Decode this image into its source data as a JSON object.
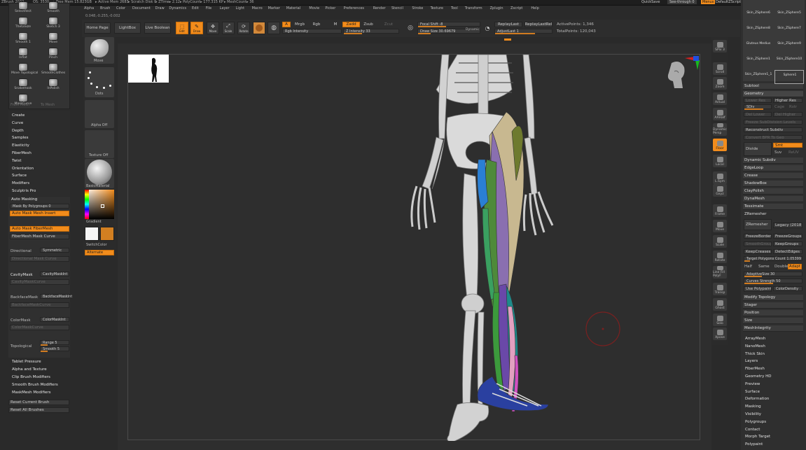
{
  "title_bar": {
    "app": "ZBrush 2022",
    "qs": "QS: 3530",
    "free_mem": "▸ Free Mem 15.823GB",
    "active_mem": "▸ Active Mem 2683",
    "scratch": "▸ Scratch Disk 0",
    "ztime": "▸ ZTime▸ 2.12",
    "polycount": "▸ PolyCount▸ 177.315 KP",
    "meshcount": "▸ MeshCount▸ 36",
    "quicksave": "QuickSave",
    "seethrough": "See-through 0",
    "menus": "Menus",
    "defaultzscript": "DefaultZScript",
    "coords": "0.048,-0.255,-0.002"
  },
  "main_menu": [
    "Alpha",
    "Brush",
    "Color",
    "Document",
    "Draw",
    "Dynamics",
    "Edit",
    "File",
    "Layer",
    "Light",
    "Macro",
    "Marker",
    "Material",
    "Movie",
    "Picker",
    "Preferences",
    "Render",
    "Stencil",
    "Stroke",
    "Texture",
    "Tool",
    "Transform",
    "Zplugin",
    "Zscript",
    "Help"
  ],
  "shelf": {
    "home_page": "Home Page",
    "lightbox": "LightBox",
    "live_boolean": "Live Boolean",
    "edit": "Edit",
    "draw": "Draw",
    "move": "Move",
    "scale": "Scale",
    "rotate": "Rotate",
    "a": "A",
    "mrgb": "Mrgb",
    "rgb": "Rgb",
    "m": "M",
    "rgb_intensity": "Rgb Intensity",
    "zadd": "Zadd",
    "zsub": "Zsub",
    "zcut": "Zcut",
    "z_intensity": "Z Intensity 33",
    "focal_shift": "Focal Shift -8",
    "draw_size": "Draw Size 30.69679",
    "dynamic": "Dynamic",
    "replay_last": "ReplayLast",
    "replay_last_rel": "ReplayLastRel",
    "adjust_last": "AdjustLast 1",
    "active_points": "ActivePoints: 1,346",
    "total_points": "TotalPoints: 120,043"
  },
  "left_brushes": {
    "row0": [
      "SelectRect",
      "Smooth"
    ],
    "row1": [
      "ThetaSize",
      "Sketch 3"
    ],
    "row2": [
      "Smooth 1",
      "Move"
    ],
    "row3": [
      "Inflat",
      "Pinch"
    ],
    "row4": [
      "Move Topological",
      "SmoothClothes"
    ],
    "row5": [
      "SnakeHook",
      "InPolish"
    ],
    "row6": [
      "MaskCurve"
    ],
    "from_mesh": "From Mesh",
    "to_mesh": "To Mesh"
  },
  "left_menu": [
    "Create",
    "Curve",
    "Depth",
    "Samples",
    "Elasticity",
    "FiberMesh",
    "Twist",
    "Orientation",
    "Surface",
    "Modifiers",
    "Sculptris Pro"
  ],
  "auto_masking": {
    "title": "Auto Masking",
    "mask_by_polygroups": "Mask By Polygroups 0",
    "auto_mask_mesh_insert": "Auto Mask Mesh Insert",
    "auto_mask_fibermesh": "Auto Mask FiberMesh",
    "fibermesh_mask_curve": "FiberMesh Mask Curve",
    "directional": "Directional",
    "symmetric": "Symmetric",
    "directional_mask_curve": "Directional Mask Curve",
    "cavity_mask": "CavityMask",
    "cavity_mask_int": "CavityMaskInt",
    "cavity_mask_curve": "CavityMaskCurve",
    "backface_mask": "BackfaceMask",
    "backface_mask_int": "BackfaceMaskInt",
    "backface_mask_curve": "BackfaceMaskCurve",
    "color_mask": "ColorMask",
    "color_mask_int": "ColorMaskInt",
    "color_mask_curve": "ColorMaskCurve",
    "topological": "Topological",
    "range": "Range 5",
    "smooth": "Smooth 5"
  },
  "left_bottom": [
    "Tablet Pressure",
    "Alpha and Texture",
    "Clip Brush Modifiers",
    "Smooth Brush Modifiers",
    "MaskMesh Modifiers"
  ],
  "reset_current_brush": "Reset Current Brush",
  "reset_all_brushes": "Reset All Brushes",
  "col2": {
    "move": "Move",
    "dots": "Dots",
    "alpha_off": "Alpha Off",
    "texture_off": "Texture Off",
    "basic_material": "BasicMaterial",
    "gradient": "Gradient",
    "switch_color": "SwitchColor",
    "alternate": "Alternate"
  },
  "right_shelf": [
    "SPix 3",
    "Scroll",
    "Zoom",
    "Actual",
    "AAHalf",
    "Dynamic Persp",
    "Floor",
    "Local",
    "L.Sym",
    "Gxyz",
    "Frame",
    "Move",
    "Scale",
    "Rotate",
    "Line Fill PolyF",
    "Transp",
    "Ghost",
    "Solo",
    "Xpose"
  ],
  "subtool_thumbs": [
    "Skin_ZSphere6",
    "Skin_ZSphere5",
    "Skin_ZSphere8",
    "Skin_ZSphere7",
    "Gluteus Medius",
    "Skin_ZSphere9",
    "Skin_ZSphere1",
    "Skin_ZSphere10",
    "Skin_ZSphere1_1",
    "Sphere1"
  ],
  "right_panel": {
    "subtool": "Subtool",
    "geometry": "Geometry",
    "lower_res": "Lower Res",
    "higher_res": "Higher Res",
    "sdiv": "SDiv",
    "cage": "Cage",
    "rstr": "Rstr",
    "del_lower": "Del Lower",
    "del_higher": "Del Higher",
    "freeze_subdiv": "Freeze SubDivision Levels",
    "reconstruct_subdiv": "Reconstruct Subdiv",
    "convert_bpr": "Convert BPR To Geo",
    "divide": "Divide",
    "smt": "Smt",
    "suv": "Suv",
    "reuv": "ReUV",
    "items": [
      "Dynamic Subdiv",
      "EdgeLoop",
      "Crease",
      "ShadowBox",
      "ClayPolish",
      "DynaMesh",
      "Tessimate"
    ],
    "zremesher_title": "ZRemesher",
    "zremesher_btn": "ZRemesher",
    "legacy": "Legacy (2018)",
    "freeze_border": "FreezeBorder",
    "freeze_groups": "FreezeGroups",
    "smooth_groups": "SmoothGroups",
    "keep_groups": "KeepGroups",
    "keep_creases": "KeepCreases",
    "detect_edges": "DetectEdges",
    "target_polygons": "Target Polygons Count 1.05399",
    "half": "Half",
    "same": "Same",
    "double": "Double",
    "adapt": "Adapt",
    "adaptive_size": "AdaptiveSize 30",
    "curves_strength": "Curves Strength 50",
    "use_polypaint": "Use Polypaint",
    "color_density": "ColorDensity",
    "tail": [
      "Modify Topology",
      "Stager",
      "Position",
      "Size",
      "MeshIntegrity"
    ]
  },
  "right_bottom": [
    "ArrayMesh",
    "NanoMesh",
    "Thick Skin",
    "Layers",
    "FiberMesh",
    "Geometry HD",
    "Preview",
    "Surface",
    "Deformation",
    "Masking",
    "Visibility",
    "Polygroups",
    "Contact",
    "Morph Target",
    "Polypaint"
  ],
  "colors": {
    "accent": "#f28c1c",
    "bg": "#2a2a2a",
    "canvas": "#2e2e2e"
  }
}
